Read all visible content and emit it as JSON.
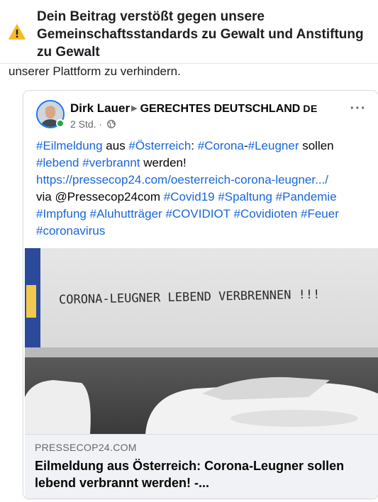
{
  "warning": {
    "icon": "warning-icon",
    "title": "Dein Beitrag verstößt gegen unsere Gemeinschaftsstandards zu Gewalt und Anstiftung zu Gewalt",
    "cutoff_text": "unserer Plattform zu verhindern."
  },
  "post": {
    "author": "Dirk Lauer",
    "group": "GERECHTES DEUTSCHLAND",
    "group_flag": "DE",
    "timestamp": "2 Std.",
    "separator": "·",
    "privacy_icon": "globe-icon",
    "more_label": "···",
    "text": {
      "t1": "#Eilmeldung",
      "t2": " aus ",
      "t3": "#Österreich",
      "t4": ": ",
      "t5": "#Corona",
      "t6": "-",
      "t7": "#Leugner",
      "t8": " sollen ",
      "t9": "#lebend",
      "t10": " ",
      "t11": "#verbrannt",
      "t12": " werden!",
      "url": "https://pressecop24.com/oesterreich-corona-leugner.../",
      "via": "via @Pressecop24com ",
      "tags": [
        "#Covid19",
        "#Spaltung",
        "#Pandemie",
        "#Impfung",
        "#Aluhutträger",
        "#COVIDIOT",
        "#Covidioten",
        "#Feuer",
        "#coronavirus"
      ]
    },
    "image_graffiti": "CORONA-LEUGNER LEBEND VERBRENNEN !!!",
    "link_preview": {
      "domain": "PRESSECOP24.COM",
      "title": "Eilmeldung aus Österreich: Corona-Leugner sollen lebend verbrannt werden! -..."
    }
  },
  "colors": {
    "link": "#1866d8",
    "warning": "#f7b928",
    "online": "#31a24c",
    "preview_bg": "#f0f2f5"
  }
}
